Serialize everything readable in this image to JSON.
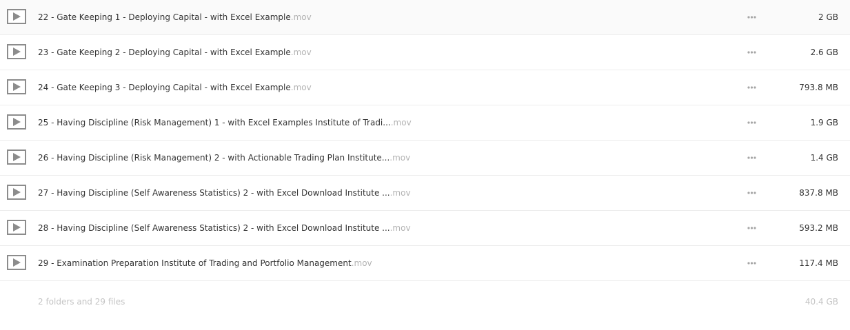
{
  "files": [
    {
      "name": "22 - Gate Keeping 1 - Deploying Capital - with Excel Example",
      "ext": ".mov",
      "size": "2 GB",
      "icon": "play-icon",
      "menu_icon": "more-options-icon"
    },
    {
      "name": "23 - Gate Keeping 2 - Deploying Capital - with Excel Example",
      "ext": ".mov",
      "size": "2.6 GB",
      "icon": "play-icon",
      "menu_icon": "more-options-icon"
    },
    {
      "name": "24 - Gate Keeping 3 - Deploying Capital - with Excel Example",
      "ext": ".mov",
      "size": "793.8 MB",
      "icon": "play-icon",
      "menu_icon": "more-options-icon"
    },
    {
      "name": "25 - Having Discipline (Risk Management) 1 - with Excel Examples Institute of Tradi...",
      "ext": ".mov",
      "size": "1.9 GB",
      "icon": "play-icon",
      "menu_icon": "more-options-icon"
    },
    {
      "name": "26 - Having Discipline (Risk Management) 2 - with Actionable Trading Plan Institute...",
      "ext": ".mov",
      "size": "1.4 GB",
      "icon": "play-icon",
      "menu_icon": "more-options-icon"
    },
    {
      "name": "27 - Having Discipline (Self Awareness Statistics) 2 - with Excel Download Institute ...",
      "ext": ".mov",
      "size": "837.8 MB",
      "icon": "play-icon",
      "menu_icon": "more-options-icon"
    },
    {
      "name": "28 - Having Discipline (Self Awareness Statistics) 2 - with Excel Download Institute ...",
      "ext": ".mov",
      "size": "593.2 MB",
      "icon": "play-icon",
      "menu_icon": "more-options-icon"
    },
    {
      "name": "29 - Examination Preparation Institute of Trading and Portfolio Management",
      "ext": ".mov",
      "size": "117.4 MB",
      "icon": "play-icon",
      "menu_icon": "more-options-icon"
    }
  ],
  "summary": {
    "count": "2 folders and 29 files",
    "total": "40.4 GB"
  },
  "colors": {
    "text": "#333333",
    "extension": "#b3b3b3",
    "summary": "#c4c4c4",
    "icon": "#8c8c8c",
    "divider": "#ececec"
  }
}
